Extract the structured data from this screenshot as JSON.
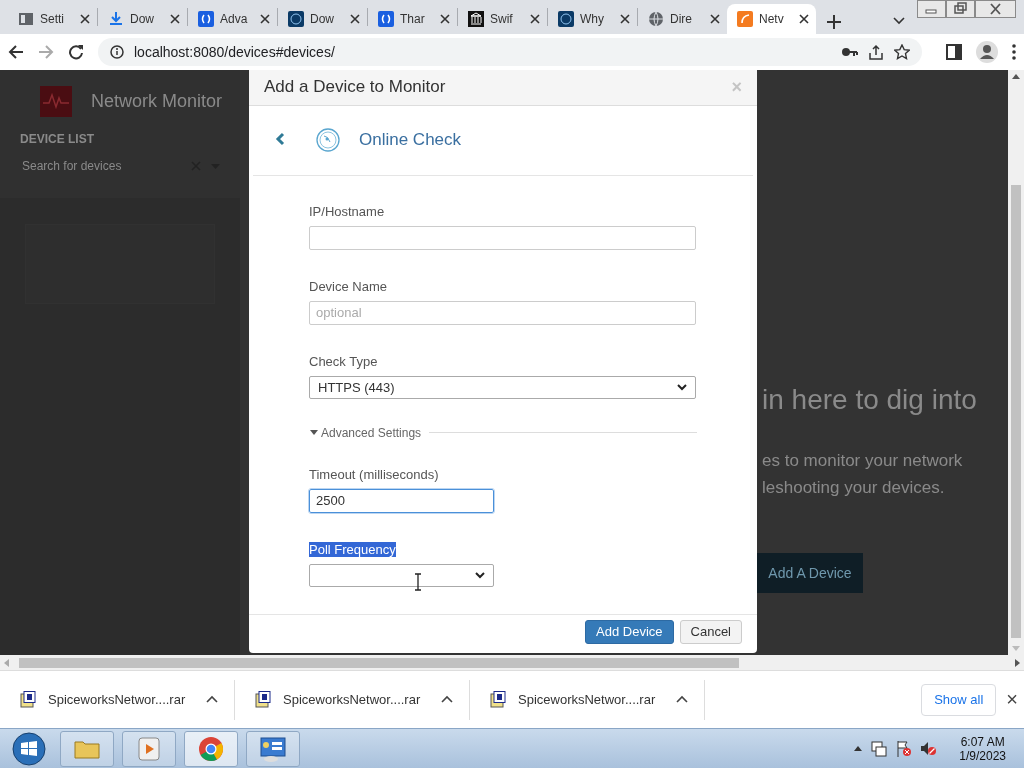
{
  "browser": {
    "tabs": [
      {
        "title": "Setti",
        "kind": "page",
        "selected": false
      },
      {
        "title": "Dow",
        "kind": "download",
        "selected": false
      },
      {
        "title": "Adva",
        "kind": "bracket",
        "selected": false
      },
      {
        "title": "Dow",
        "kind": "globe-dark",
        "selected": false
      },
      {
        "title": "Thar",
        "kind": "bracket",
        "selected": false
      },
      {
        "title": "Swif",
        "kind": "bank",
        "selected": false
      },
      {
        "title": "Why",
        "kind": "globe-dark",
        "selected": false
      },
      {
        "title": "Dire",
        "kind": "globe",
        "selected": false
      },
      {
        "title": "Netv",
        "kind": "app",
        "selected": true
      }
    ],
    "url": "localhost:8080/devices#devices/"
  },
  "background_page": {
    "app_title": "Network Monitor",
    "device_list_heading": "DEVICE LIST",
    "search_placeholder": "Search for devices",
    "headline": "in here to dig into",
    "description": [
      "es to monitor your network",
      "leshooting your devices."
    ],
    "add_button": "Add A Device"
  },
  "modal": {
    "title": "Add a Device to Monitor",
    "close": "×",
    "check_name": "Online Check",
    "fields": [
      {
        "kind": "text",
        "label": "IP/Hostname"
      },
      {
        "kind": "text",
        "label": "Device Name",
        "placeholder": "optional"
      },
      {
        "kind": "select",
        "label": "Check Type",
        "value": "HTTPS (443)"
      }
    ],
    "advanced": {
      "label": "Advanced Settings",
      "expanded": true
    },
    "advanced_fields": [
      {
        "kind": "text",
        "label": "Timeout (milliseconds)",
        "value": "2500",
        "focused": true,
        "label_highlighted": false
      },
      {
        "kind": "select",
        "label": "Poll Frequency",
        "focused": false,
        "label_highlighted": true
      }
    ],
    "buttons": [
      {
        "label": "Add Device",
        "primary": true
      },
      {
        "label": "Cancel",
        "primary": false
      }
    ]
  },
  "downloads": {
    "items": [
      {
        "name": "SpiceworksNetwor....rar"
      },
      {
        "name": "SpiceworksNetwor....rar"
      },
      {
        "name": "SpiceworksNetwor....rar"
      }
    ],
    "show_all": "Show all",
    "close": "×"
  },
  "taskbar": {
    "apps": [
      {
        "kind": "folder",
        "active": false
      },
      {
        "kind": "media",
        "active": false
      },
      {
        "kind": "chrome",
        "active": true
      },
      {
        "kind": "panel",
        "active": false
      }
    ],
    "time": "6:07 AM",
    "date": "1/9/2023"
  }
}
